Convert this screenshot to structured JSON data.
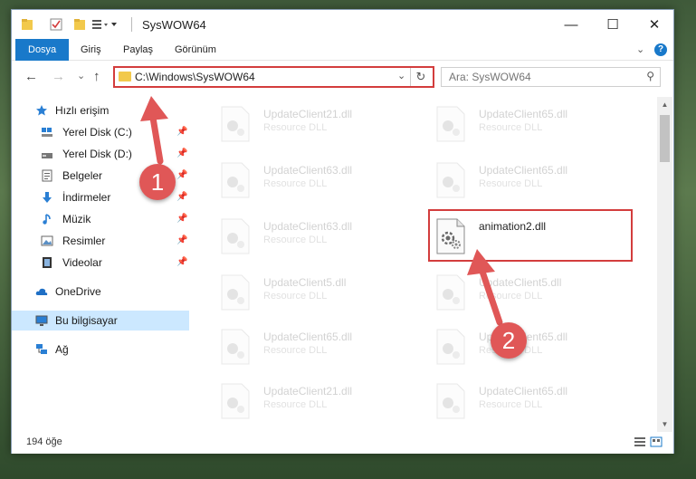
{
  "window": {
    "title": "SysWOW64",
    "minimize": "—",
    "maximize": "☐",
    "close": "✕"
  },
  "ribbon": {
    "tabs": [
      "Dosya",
      "Giriş",
      "Paylaş",
      "Görünüm"
    ],
    "expand": "⌄",
    "help": "?"
  },
  "address": {
    "path": "C:\\Windows\\SysWOW64",
    "dropdown": "⌄",
    "refresh": "↻"
  },
  "search": {
    "placeholder": "Ara: SysWOW64",
    "icon": "⚲"
  },
  "nav": {
    "back": "←",
    "forward": "→",
    "recent": "⌄",
    "up": "↑"
  },
  "sidebar": {
    "items": [
      {
        "label": "Hızlı erişim",
        "icon": "star-icon",
        "pinned": false
      },
      {
        "label": "Yerel Disk (C:)",
        "icon": "drive-icon",
        "pinned": true
      },
      {
        "label": "Yerel Disk (D:)",
        "icon": "drive-icon",
        "pinned": true
      },
      {
        "label": "Belgeler",
        "icon": "document-icon",
        "pinned": true
      },
      {
        "label": "İndirmeler",
        "icon": "download-icon",
        "pinned": true
      },
      {
        "label": "Müzik",
        "icon": "music-icon",
        "pinned": true
      },
      {
        "label": "Resimler",
        "icon": "picture-icon",
        "pinned": true
      },
      {
        "label": "Videolar",
        "icon": "video-icon",
        "pinned": true
      },
      {
        "label": "OneDrive",
        "icon": "cloud-icon",
        "pinned": false
      },
      {
        "label": "Bu bilgisayar",
        "icon": "computer-icon",
        "pinned": false
      },
      {
        "label": "Ağ",
        "icon": "network-icon",
        "pinned": false
      }
    ],
    "pin_glyph": "📌"
  },
  "files": [
    {
      "name": "UpdateClient21.dll",
      "type": "Resource DLL"
    },
    {
      "name": "UpdateClient65.dll",
      "type": "Resource DLL"
    },
    {
      "name": "UpdateClient63.dll",
      "type": "Resource DLL"
    },
    {
      "name": "UpdateClient65.dll",
      "type": "Resource DLL"
    },
    {
      "name": "UpdateClient63.dll",
      "type": "Resource DLL"
    },
    {
      "name": "animation2.dll",
      "type": ""
    },
    {
      "name": "UpdateClient5.dll",
      "type": "Resource DLL"
    },
    {
      "name": "UpdateClient5.dll",
      "type": "Resource DLL"
    },
    {
      "name": "UpdateClient65.dll",
      "type": "Resource DLL"
    },
    {
      "name": "UpdateClient65.dll",
      "type": "Resource DLL"
    },
    {
      "name": "UpdateClient21.dll",
      "type": "Resource DLL"
    },
    {
      "name": "UpdateClient65.dll",
      "type": "Resource DLL"
    }
  ],
  "status": {
    "count": "194 öğe"
  },
  "markers": {
    "step1": "1",
    "step2": "2"
  },
  "colors": {
    "accent": "#1979ca",
    "highlight": "#d33d3d",
    "marker": "#e05757",
    "selected": "#cce8ff"
  }
}
